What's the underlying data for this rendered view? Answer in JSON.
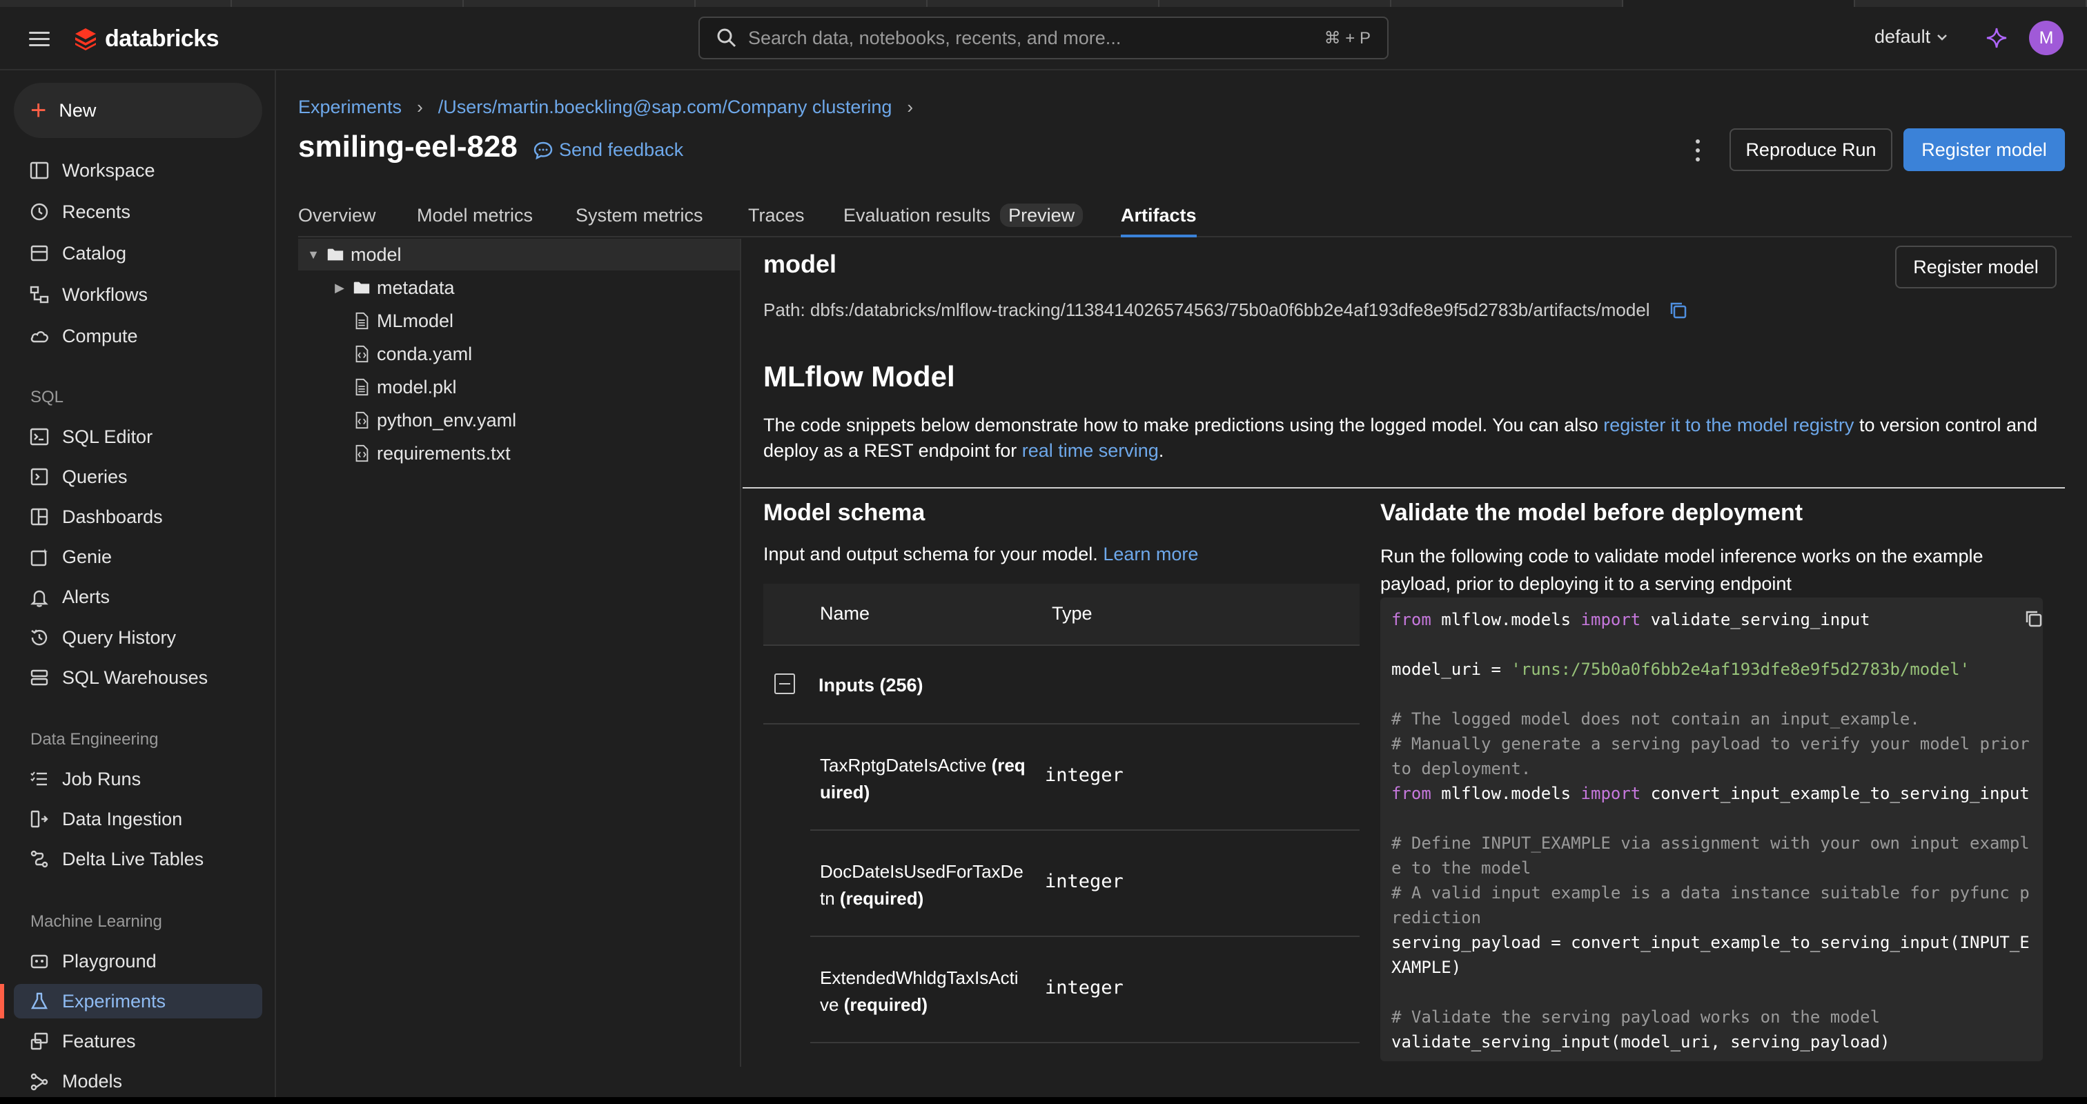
{
  "header": {
    "brand": "databricks",
    "search_placeholder": "Search data, notebooks, recents, and more...",
    "search_shortcut": "⌘ + P",
    "workspace": "default",
    "avatar_initial": "M"
  },
  "sidebar": {
    "new_label": "New",
    "items_top": [
      {
        "label": "Workspace",
        "icon": "workspace-icon"
      },
      {
        "label": "Recents",
        "icon": "clock-icon"
      },
      {
        "label": "Catalog",
        "icon": "catalog-icon"
      },
      {
        "label": "Workflows",
        "icon": "workflows-icon"
      },
      {
        "label": "Compute",
        "icon": "cloud-icon"
      }
    ],
    "sql_section": "SQL",
    "items_sql": [
      {
        "label": "SQL Editor",
        "icon": "sql-editor-icon"
      },
      {
        "label": "Queries",
        "icon": "queries-icon"
      },
      {
        "label": "Dashboards",
        "icon": "dashboards-icon"
      },
      {
        "label": "Genie",
        "icon": "genie-icon"
      },
      {
        "label": "Alerts",
        "icon": "bell-icon"
      },
      {
        "label": "Query History",
        "icon": "history-icon"
      },
      {
        "label": "SQL Warehouses",
        "icon": "warehouse-icon"
      }
    ],
    "de_section": "Data Engineering",
    "items_de": [
      {
        "label": "Job Runs",
        "icon": "job-runs-icon"
      },
      {
        "label": "Data Ingestion",
        "icon": "ingestion-icon"
      },
      {
        "label": "Delta Live Tables",
        "icon": "pipelines-icon"
      }
    ],
    "ml_section": "Machine Learning",
    "items_ml": [
      {
        "label": "Playground",
        "icon": "playground-icon"
      },
      {
        "label": "Experiments",
        "icon": "flask-icon",
        "active": true
      },
      {
        "label": "Features",
        "icon": "features-icon"
      },
      {
        "label": "Models",
        "icon": "models-icon"
      }
    ]
  },
  "breadcrumb": {
    "experiments": "Experiments",
    "path": "/Users/martin.boeckling@sap.com/Company clustering"
  },
  "run": {
    "title": "smiling-eel-828",
    "feedback": "Send feedback",
    "reproduce": "Reproduce Run",
    "register": "Register model"
  },
  "tabs": [
    {
      "label": "Overview"
    },
    {
      "label": "Model metrics"
    },
    {
      "label": "System metrics"
    },
    {
      "label": "Traces"
    },
    {
      "label": "Evaluation results",
      "badge": "Preview"
    },
    {
      "label": "Artifacts",
      "active": true
    }
  ],
  "tree": [
    {
      "label": "model",
      "type": "folder",
      "expanded": true,
      "level": 0
    },
    {
      "label": "metadata",
      "type": "folder",
      "expanded": false,
      "level": 1
    },
    {
      "label": "MLmodel",
      "type": "file",
      "level": 1
    },
    {
      "label": "conda.yaml",
      "type": "code-file",
      "level": 1
    },
    {
      "label": "model.pkl",
      "type": "file",
      "level": 1
    },
    {
      "label": "python_env.yaml",
      "type": "code-file",
      "level": 1
    },
    {
      "label": "requirements.txt",
      "type": "code-file",
      "level": 1
    }
  ],
  "artifact": {
    "title": "model",
    "register": "Register model",
    "path": "Path: dbfs:/databricks/mlflow-tracking/1138414026574563/75b0a0f6bb2e4af193dfe8e9f5d2783b/artifacts/model",
    "mlflow_title": "MLflow Model",
    "desc_part1": "The code snippets below demonstrate how to make predictions using the logged model. You can also ",
    "desc_link1": "register it to the model registry",
    "desc_part2": " to version control and deploy as a REST endpoint for ",
    "desc_link2": "real time serving",
    "desc_part3": "."
  },
  "schema": {
    "title": "Model schema",
    "desc": "Input and output schema for your model.",
    "learn_more": "Learn more",
    "col_name": "Name",
    "col_type": "Type",
    "inputs_label": "Inputs (256)",
    "required": "(required)",
    "rows": [
      {
        "name": "TaxRptgDateIsActive",
        "type": "integer"
      },
      {
        "name": "DocDateIsUsedForTaxDetn",
        "type": "integer"
      },
      {
        "name": "ExtendedWhldgTaxIsActive",
        "type": "integer"
      }
    ]
  },
  "validate": {
    "title": "Validate the model before deployment",
    "desc": "Run the following code to validate model inference works on the example payload, prior to deploying it to a serving endpoint",
    "code": [
      [
        {
          "t": "from",
          "c": "kw"
        },
        {
          "t": " mlflow.models "
        },
        {
          "t": "import",
          "c": "kw"
        },
        {
          "t": " validate_serving_input"
        }
      ],
      [],
      [
        {
          "t": "model_uri = "
        },
        {
          "t": "'runs:/75b0a0f6bb2e4af193dfe8e9f5d2783b/model'",
          "c": "st"
        }
      ],
      [],
      [
        {
          "t": "# The logged model does not contain an input_example.",
          "c": "cm"
        }
      ],
      [
        {
          "t": "# Manually generate a serving payload to verify your model prior to deployment.",
          "c": "cm"
        }
      ],
      [
        {
          "t": "from",
          "c": "kw"
        },
        {
          "t": " mlflow.models "
        },
        {
          "t": "import",
          "c": "kw"
        },
        {
          "t": " convert_input_example_to_serving_input"
        }
      ],
      [],
      [
        {
          "t": "# Define INPUT_EXAMPLE via assignment with your own input example to the model",
          "c": "cm"
        }
      ],
      [
        {
          "t": "# A valid input example is a data instance suitable for pyfunc prediction",
          "c": "cm"
        }
      ],
      [
        {
          "t": "serving_payload = convert_input_example_to_serving_input(INPUT_EXAMPLE)"
        }
      ],
      [],
      [
        {
          "t": "# Validate the serving payload works on the model",
          "c": "cm"
        }
      ],
      [
        {
          "t": "validate_serving_input(model_uri, serving_payload)"
        }
      ]
    ]
  }
}
